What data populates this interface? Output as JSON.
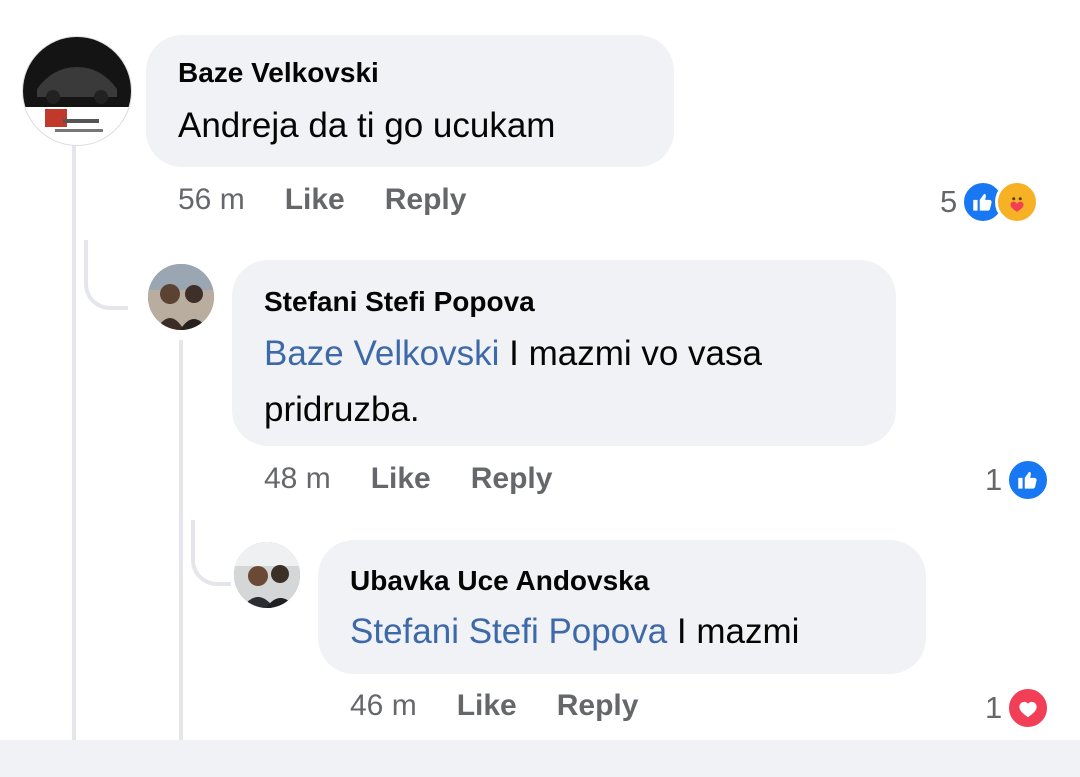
{
  "comments": [
    {
      "author": "Baze Velkovski",
      "mention": "",
      "text": "Andreja da ti go ucukam",
      "time": "56 m",
      "like_label": "Like",
      "reply_label": "Reply",
      "reaction_count": "5",
      "reactions": [
        "like-icon",
        "care-icon"
      ]
    },
    {
      "author": "Stefani Stefi Popova",
      "mention": "Baze Velkovski",
      "text": "I mazmi vo vasa",
      "text_line2": "pridruzba.",
      "time": "48 m",
      "like_label": "Like",
      "reply_label": "Reply",
      "reaction_count": "1",
      "reactions": [
        "like-icon"
      ]
    },
    {
      "author": "Ubavka Uce Andovska",
      "mention": "Stefani Stefi Popova",
      "text": "I mazmi",
      "time": "46 m",
      "like_label": "Like",
      "reply_label": "Reply",
      "reaction_count": "1",
      "reactions": [
        "love-icon"
      ]
    }
  ],
  "colors": {
    "bubble": "#f0f2f5",
    "mention": "#3e69a8",
    "meta": "#65676b",
    "like_blue": "#1877f2",
    "love_red": "#f33e58",
    "care_yellow": "#f7b125"
  }
}
